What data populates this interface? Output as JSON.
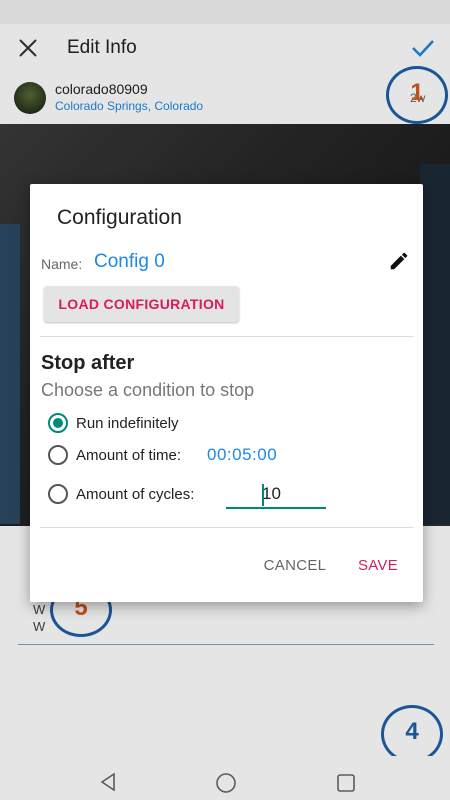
{
  "app": {
    "title": "Edit Info",
    "user": {
      "name": "colorado80909",
      "location": "Colorado Springs, Colorado",
      "right_text": "2w"
    },
    "body_text": "W\nW",
    "callouts": [
      "1",
      "4",
      "5"
    ]
  },
  "dialog": {
    "title": "Configuration",
    "name_label": "Name:",
    "name_value": "Config 0",
    "load_button": "LOAD CONFIGURATION",
    "section_title": "Stop after",
    "section_subtitle": "Choose a condition to stop",
    "options": [
      {
        "label": "Run indefinitely",
        "selected": true
      },
      {
        "label": "Amount of time:",
        "selected": false
      },
      {
        "label": "Amount of cycles:",
        "selected": false
      }
    ],
    "time_value": "00:05:00",
    "cycles_value": "10",
    "cancel_label": "CANCEL",
    "save_label": "SAVE"
  },
  "colors": {
    "accent_teal": "#00897b",
    "accent_pink": "#d81b60",
    "link_blue": "#1e88e5",
    "callout_blue": "#1e5fa8"
  },
  "icons": [
    "close-icon",
    "check-icon",
    "pencil-icon",
    "nav-back-icon",
    "nav-home-icon",
    "nav-recents-icon"
  ]
}
